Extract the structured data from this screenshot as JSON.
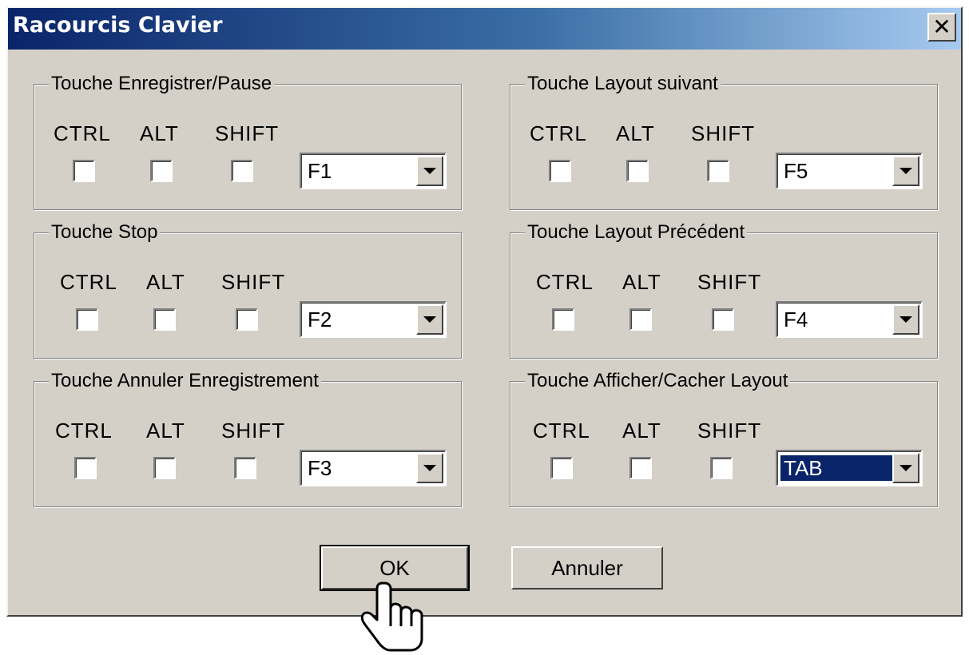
{
  "window": {
    "title": "Racourcis Clavier",
    "close_symbol": "✕"
  },
  "modifiers": {
    "ctrl": "CTRL",
    "alt": "ALT",
    "shift": "SHIFT"
  },
  "groups": [
    {
      "title": "Touche Enregistrer/Pause",
      "key": "F1",
      "selected": false
    },
    {
      "title": "Touche Layout suivant",
      "key": "F5",
      "selected": false
    },
    {
      "title": "Touche Stop",
      "key": "F2",
      "selected": false
    },
    {
      "title": "Touche Layout Précédent",
      "key": "F4",
      "selected": false
    },
    {
      "title": "Touche Annuler Enregistrement",
      "key": "F3",
      "selected": false
    },
    {
      "title": "Touche Afficher/Cacher Layout",
      "key": "TAB",
      "selected": true
    }
  ],
  "buttons": {
    "ok": "OK",
    "cancel": "Annuler"
  },
  "colors": {
    "face": "#d4d0c8",
    "title_start": "#0a246a",
    "title_end": "#a6caf0",
    "selection": "#0a246a"
  },
  "cursor": {
    "icon": "hand-pointer-icon"
  }
}
